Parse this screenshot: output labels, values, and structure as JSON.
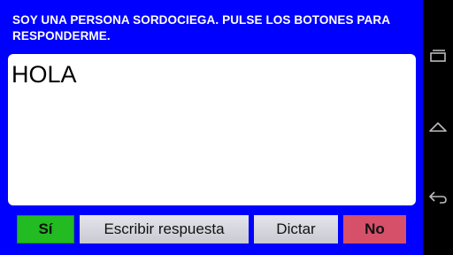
{
  "header": {
    "text": "SOY UNA PERSONA SORDOCIEGA. PULSE LOS BOTONES PARA RESPONDERME."
  },
  "message": {
    "text": "HOLA"
  },
  "buttons": {
    "si": "Sí",
    "escribir": "Escribir respuesta",
    "dictar": "Dictar",
    "no": "No"
  },
  "navbar": {
    "icons": [
      "recent-apps-icon",
      "home-icon",
      "back-icon"
    ]
  },
  "colors": {
    "background": "#0000ff",
    "si": "#22bb22",
    "no": "#d6506a",
    "neutral": "#d6d6de"
  }
}
